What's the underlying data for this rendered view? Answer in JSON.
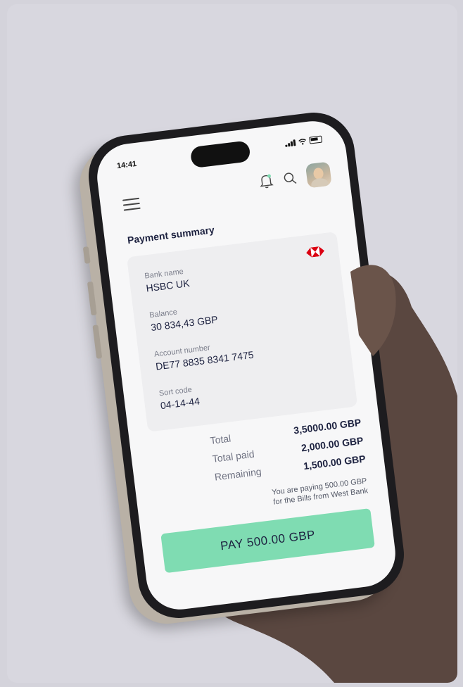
{
  "status": {
    "time": "14:41"
  },
  "header": {
    "title": "Payment summary"
  },
  "card": {
    "bank_name_label": "Bank name",
    "bank_name": "HSBC UK",
    "balance_label": "Balance",
    "balance": "30 834,43 GBP",
    "account_label": "Account number",
    "account": "DE77 8835 8341 7475",
    "sort_label": "Sort code",
    "sort": "04-14-44"
  },
  "totals": {
    "total_label": "Total",
    "total": "3,5000.00 GBP",
    "paid_label": "Total paid",
    "paid": "2,000.00 GBP",
    "remaining_label": "Remaining",
    "remaining": "1,500.00 GBP"
  },
  "note": {
    "line1": "You are paying 500.00 GBP",
    "line2": "for the Bills from West Bank"
  },
  "pay_button": {
    "label": "PAY 500.00 GBP"
  },
  "colors": {
    "accent": "#7fdcb2",
    "background": "#d4d3db",
    "text": "#1d2240",
    "logo_red": "#db0011"
  }
}
